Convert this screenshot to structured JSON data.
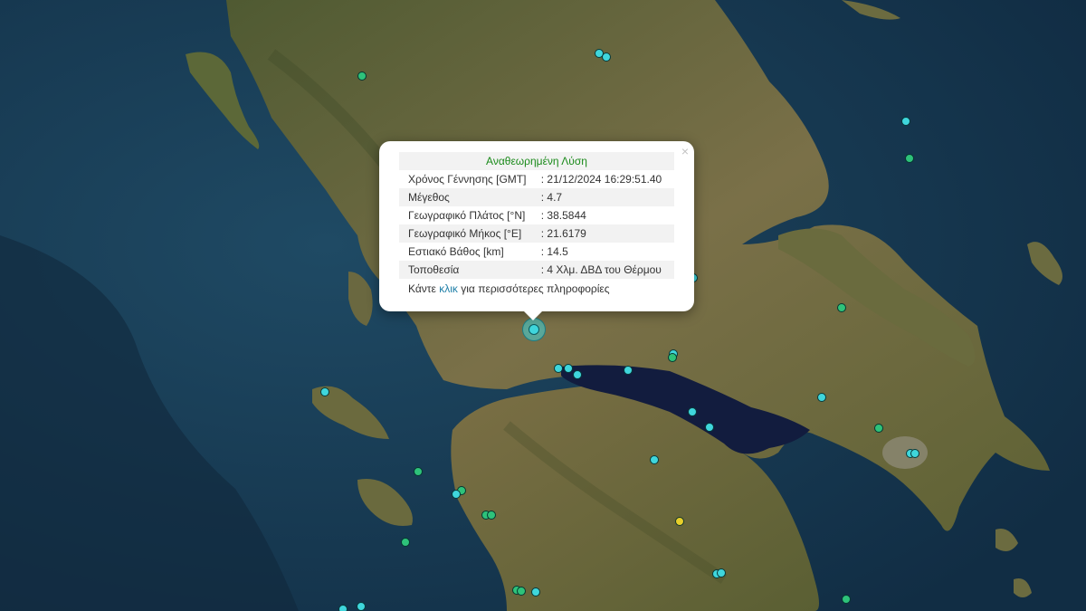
{
  "popup": {
    "title": "Αναθεωρημένη Λύση",
    "close_symbol": "×",
    "rows": [
      {
        "label": "Χρόνος Γέννησης [GMT]",
        "value": ": 21/12/2024 16:29:51.40"
      },
      {
        "label": "Μέγεθος",
        "value": ": 4.7"
      },
      {
        "label": "Γεωγραφικό Πλάτος [°N]",
        "value": ": 38.5844"
      },
      {
        "label": "Γεωγραφικό Μήκος [°E]",
        "value": ": 21.6179"
      },
      {
        "label": "Εστιακό Βάθος [km]",
        "value": ": 14.5"
      },
      {
        "label": "Τοποθεσία",
        "value": ": 4 Χλμ. ΔΒΔ του Θέρμου"
      }
    ],
    "more_prefix": "Κάντε",
    "more_link": "κλικ",
    "more_suffix": "για περισσότερες πληροφορίες"
  },
  "colors": {
    "sea": "#173a52",
    "land": "#6b6a3c",
    "gulf": "#121c3e",
    "marker_cyan": "#3fd6dc",
    "marker_green": "#2ec27a",
    "marker_yellow": "#e8cf2a"
  },
  "markers": {
    "count_visible": 40,
    "legend_colors": [
      "cyan",
      "green",
      "yellow"
    ]
  }
}
